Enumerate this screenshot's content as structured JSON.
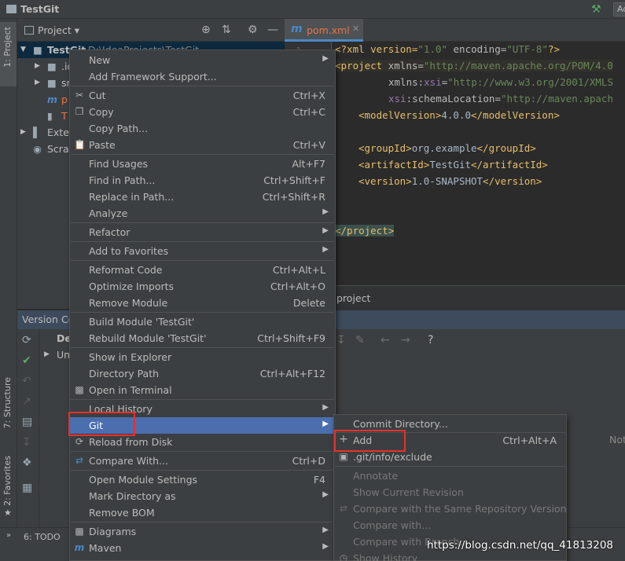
{
  "window": {
    "title": "TestGit",
    "add_config_label": "Ad"
  },
  "left_strip": {
    "tabs": [
      "1: Project",
      "7: Structure",
      "2: Favorites"
    ]
  },
  "project_panel": {
    "selector_label": "Project",
    "tree": [
      {
        "name": "TestGit",
        "path": "D:\\IdeaProjects\\TestGit"
      },
      {
        "name": ".id"
      },
      {
        "name": "sr"
      },
      {
        "name": "p"
      },
      {
        "name": "T"
      },
      {
        "name": "Extern"
      },
      {
        "name": "Scrat"
      }
    ]
  },
  "editor": {
    "tab_label": "pom.xml",
    "line_number": "1",
    "breadcrumb": "project",
    "lines": [
      [
        "<?xml version=",
        "\"1.0\"",
        " encoding=",
        "\"UTF-8\"",
        "?>"
      ],
      [
        "<project",
        " xmlns=",
        "\"http://maven.apache.org/POM/4.0"
      ],
      [
        "xmlns:",
        "xsi",
        "=",
        "\"http://www.w3.org/2001/XMLS"
      ],
      [
        "xsi",
        ":schemaLocation=",
        "\"http://maven.apach"
      ],
      [
        "<modelVersion>",
        "4.0.0",
        "</modelVersion>"
      ],
      [
        "<groupId>",
        "org.example",
        "</groupId>"
      ],
      [
        "<artifactId>",
        "TestGit",
        "</artifactId>"
      ],
      [
        "<version>",
        "1.0-SNAPSHOT",
        "</version>"
      ],
      [
        "</project>"
      ]
    ]
  },
  "version_control": {
    "header": "Version Co",
    "tree_items": [
      "De",
      "Un"
    ],
    "right_label": "Not"
  },
  "bottom": {
    "todo_label": "6: TODO"
  },
  "context_menu": {
    "items": [
      {
        "label": "New",
        "shortcut": "",
        "submenu": true
      },
      {
        "label": "Add Framework Support...",
        "shortcut": ""
      },
      {
        "label": "Cut",
        "shortcut": "Ctrl+X",
        "icon": "scissors-icon"
      },
      {
        "label": "Copy",
        "shortcut": "Ctrl+C",
        "icon": "copy-icon"
      },
      {
        "label": "Copy Path...",
        "shortcut": ""
      },
      {
        "label": "Paste",
        "shortcut": "Ctrl+V",
        "icon": "paste-icon"
      },
      {
        "label": "Find Usages",
        "shortcut": "Alt+F7"
      },
      {
        "label": "Find in Path...",
        "shortcut": "Ctrl+Shift+F"
      },
      {
        "label": "Replace in Path...",
        "shortcut": "Ctrl+Shift+R"
      },
      {
        "label": "Analyze",
        "shortcut": "",
        "submenu": true
      },
      {
        "label": "Refactor",
        "shortcut": "",
        "submenu": true
      },
      {
        "label": "Add to Favorites",
        "shortcut": "",
        "submenu": true
      },
      {
        "label": "Reformat Code",
        "shortcut": "Ctrl+Alt+L"
      },
      {
        "label": "Optimize Imports",
        "shortcut": "Ctrl+Alt+O"
      },
      {
        "label": "Remove Module",
        "shortcut": "Delete"
      },
      {
        "label": "Build Module 'TestGit'",
        "shortcut": ""
      },
      {
        "label": "Rebuild Module 'TestGit'",
        "shortcut": "Ctrl+Shift+F9"
      },
      {
        "label": "Show in Explorer",
        "shortcut": ""
      },
      {
        "label": "Directory Path",
        "shortcut": "Ctrl+Alt+F12"
      },
      {
        "label": "Open in Terminal",
        "shortcut": "",
        "icon": "terminal-icon"
      },
      {
        "label": "Local History",
        "shortcut": "",
        "submenu": true
      },
      {
        "label": "Git",
        "shortcut": "",
        "submenu": true,
        "active": true
      },
      {
        "label": "Reload from Disk",
        "shortcut": "",
        "icon": "reload-icon"
      },
      {
        "label": "Compare With...",
        "shortcut": "Ctrl+D",
        "icon": "compare-icon"
      },
      {
        "label": "Open Module Settings",
        "shortcut": "F4"
      },
      {
        "label": "Mark Directory as",
        "shortcut": "",
        "submenu": true
      },
      {
        "label": "Remove BOM",
        "shortcut": ""
      },
      {
        "label": "Diagrams",
        "shortcut": "",
        "submenu": true,
        "icon": "diagram-icon"
      },
      {
        "label": "Maven",
        "shortcut": "",
        "submenu": true,
        "icon": "maven-icon"
      }
    ]
  },
  "git_submenu": {
    "items": [
      {
        "label": "Commit Directory...",
        "shortcut": ""
      },
      {
        "label": "Add",
        "shortcut": "Ctrl+Alt+A",
        "icon": "plus-icon"
      },
      {
        "label": ".git/info/exclude",
        "shortcut": "",
        "icon": "exclude-icon"
      },
      {
        "label": "Annotate",
        "shortcut": "",
        "disabled": true
      },
      {
        "label": "Show Current Revision",
        "shortcut": "",
        "disabled": true
      },
      {
        "label": "Compare with the Same Repository Version",
        "shortcut": "",
        "disabled": true
      },
      {
        "label": "Compare with...",
        "shortcut": "",
        "disabled": true
      },
      {
        "label": "Compare with Branch...",
        "shortcut": "",
        "disabled": true
      },
      {
        "label": "Show History",
        "shortcut": "",
        "disabled": true
      }
    ]
  },
  "watermark": "https://blog.csdn.net/qq_41813208"
}
